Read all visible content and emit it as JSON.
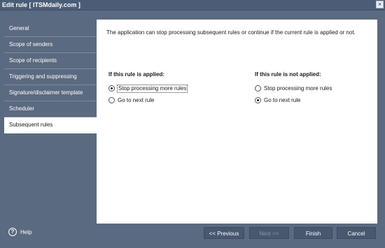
{
  "window": {
    "title": "Edit rule [ ITSMdaily.com ]",
    "close_glyph": "×"
  },
  "sidebar": {
    "items": [
      {
        "label": "General"
      },
      {
        "label": "Scope of senders"
      },
      {
        "label": "Scope of recipients"
      },
      {
        "label": "Triggering and suppressing"
      },
      {
        "label": "Signature/disclaimer template"
      },
      {
        "label": "Scheduler"
      },
      {
        "label": "Subsequent rules"
      }
    ],
    "active_item": "Subsequent rules"
  },
  "main": {
    "intro": "The application can stop processing subsequent rules or continue if the current rule is applied or not.",
    "applied": {
      "heading": "If this rule is applied:",
      "options": [
        "Stop processing more rules",
        "Go to next rule"
      ],
      "selected": "Stop processing more rules"
    },
    "not_applied": {
      "heading": "If this rule is not applied:",
      "options": [
        "Stop processing more rules",
        "Go to next rule"
      ],
      "selected": "Go to next rule"
    }
  },
  "footer": {
    "help_icon": "?",
    "help_label": "Help",
    "previous_label": "<< Previous",
    "next_label": "Next >>",
    "next_enabled": false,
    "finish_label": "Finish",
    "cancel_label": "Cancel"
  },
  "colors": {
    "chrome": "#5a6a80",
    "titlebar": "#4b5d76",
    "button": "#48586e",
    "panel": "#ffffff"
  }
}
